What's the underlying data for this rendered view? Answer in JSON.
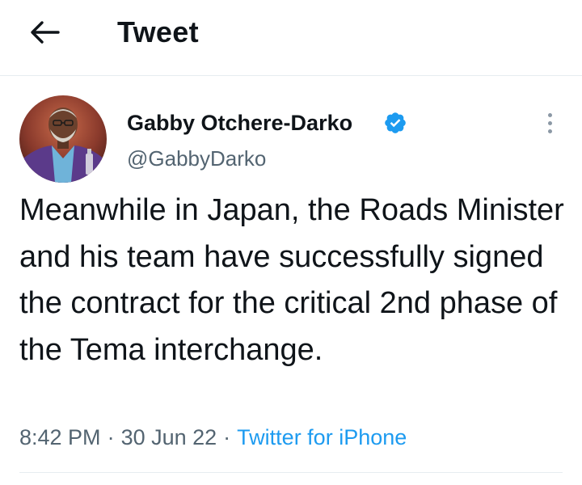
{
  "header": {
    "back_icon": "arrow-left-icon",
    "title": "Tweet"
  },
  "tweet": {
    "author": {
      "display_name": "Gabby Otchere-Darko",
      "handle": "@GabbyDarko",
      "verified_icon": "verified-badge-icon",
      "avatar_icon": "avatar"
    },
    "more_icon": "more-vertical-icon",
    "text": "Meanwhile in Japan, the Roads Minister and his team have successfully signed the contract for the critical 2nd phase of the Tema interchange.",
    "time": "8:42 PM",
    "date": "30 Jun 22",
    "separator": "·",
    "source": "Twitter for iPhone"
  },
  "colors": {
    "accent": "#1d9bf0",
    "text_primary": "#0f1419",
    "text_secondary": "#536471",
    "divider": "#e6ecf0"
  }
}
